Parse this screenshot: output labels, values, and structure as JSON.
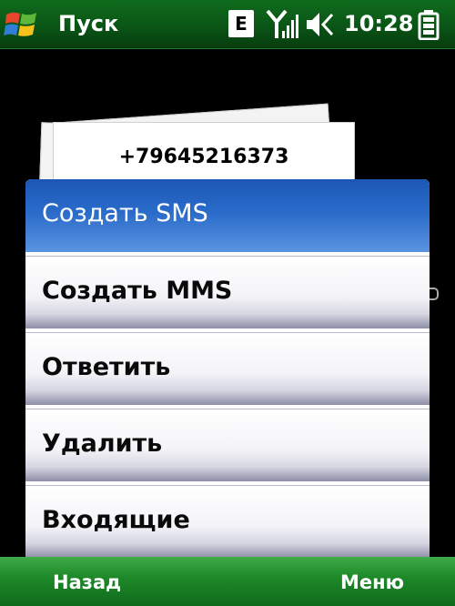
{
  "status_bar": {
    "title": "Пуск",
    "network_type": "E",
    "time": "10:28",
    "icons": [
      "windows-start-icon",
      "signal-icon",
      "volume-icon",
      "battery-icon"
    ]
  },
  "message": {
    "sender": "+79645216373"
  },
  "context_menu": {
    "items": [
      {
        "label": "Создать SMS",
        "selected": true
      },
      {
        "label": "Создать MMS",
        "selected": false
      },
      {
        "label": "Ответить",
        "selected": false
      },
      {
        "label": "Удалить",
        "selected": false
      },
      {
        "label": "Входящие",
        "selected": false
      }
    ]
  },
  "softkeys": {
    "left": "Назад",
    "right": "Меню"
  },
  "colors": {
    "bar_green": "#0a5516",
    "selection_blue": "#1c57b6"
  }
}
